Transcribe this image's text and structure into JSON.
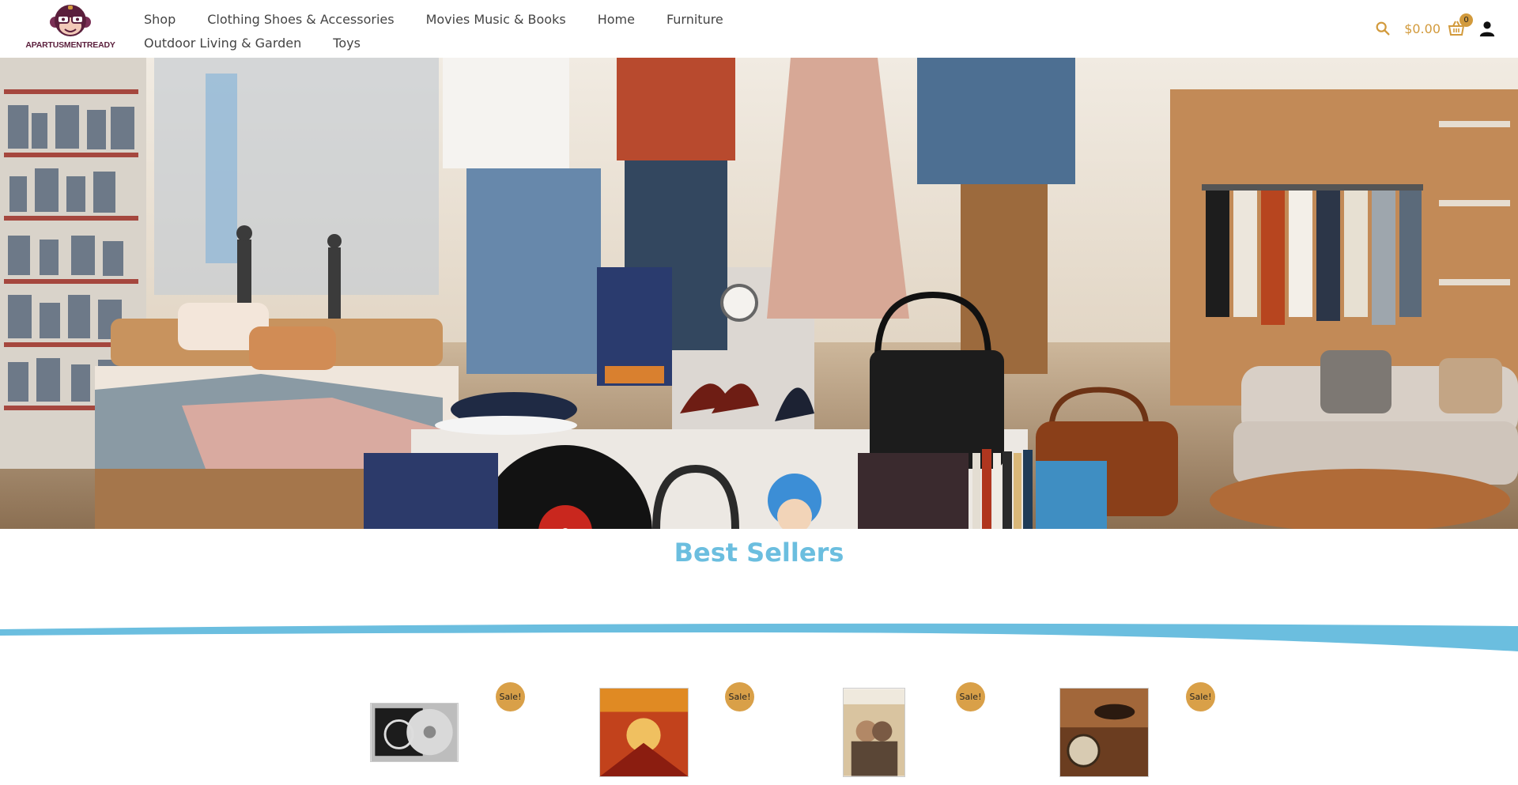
{
  "brand": {
    "logo_text": "APARTUSMENTREADY"
  },
  "nav": {
    "row1": [
      "Shop",
      "Clothing Shoes & Accessories",
      "Movies Music & Books",
      "Home",
      "Furniture"
    ],
    "row2": [
      "Outdoor Living & Garden",
      "Toys"
    ]
  },
  "header": {
    "cart_total": "$0.00",
    "cart_count": "0"
  },
  "section": {
    "title": "Best Sellers"
  },
  "products": [
    {
      "sale": "Sale!"
    },
    {
      "sale": "Sale!"
    },
    {
      "sale": "Sale!"
    },
    {
      "sale": "Sale!"
    }
  ],
  "colors": {
    "accent": "#d29a3c",
    "title": "#6bbedf",
    "wave": "#6bbedf",
    "brand": "#5b1f3c"
  },
  "icons": [
    "monkey-logo-icon",
    "search-icon",
    "cart-icon",
    "user-icon"
  ]
}
